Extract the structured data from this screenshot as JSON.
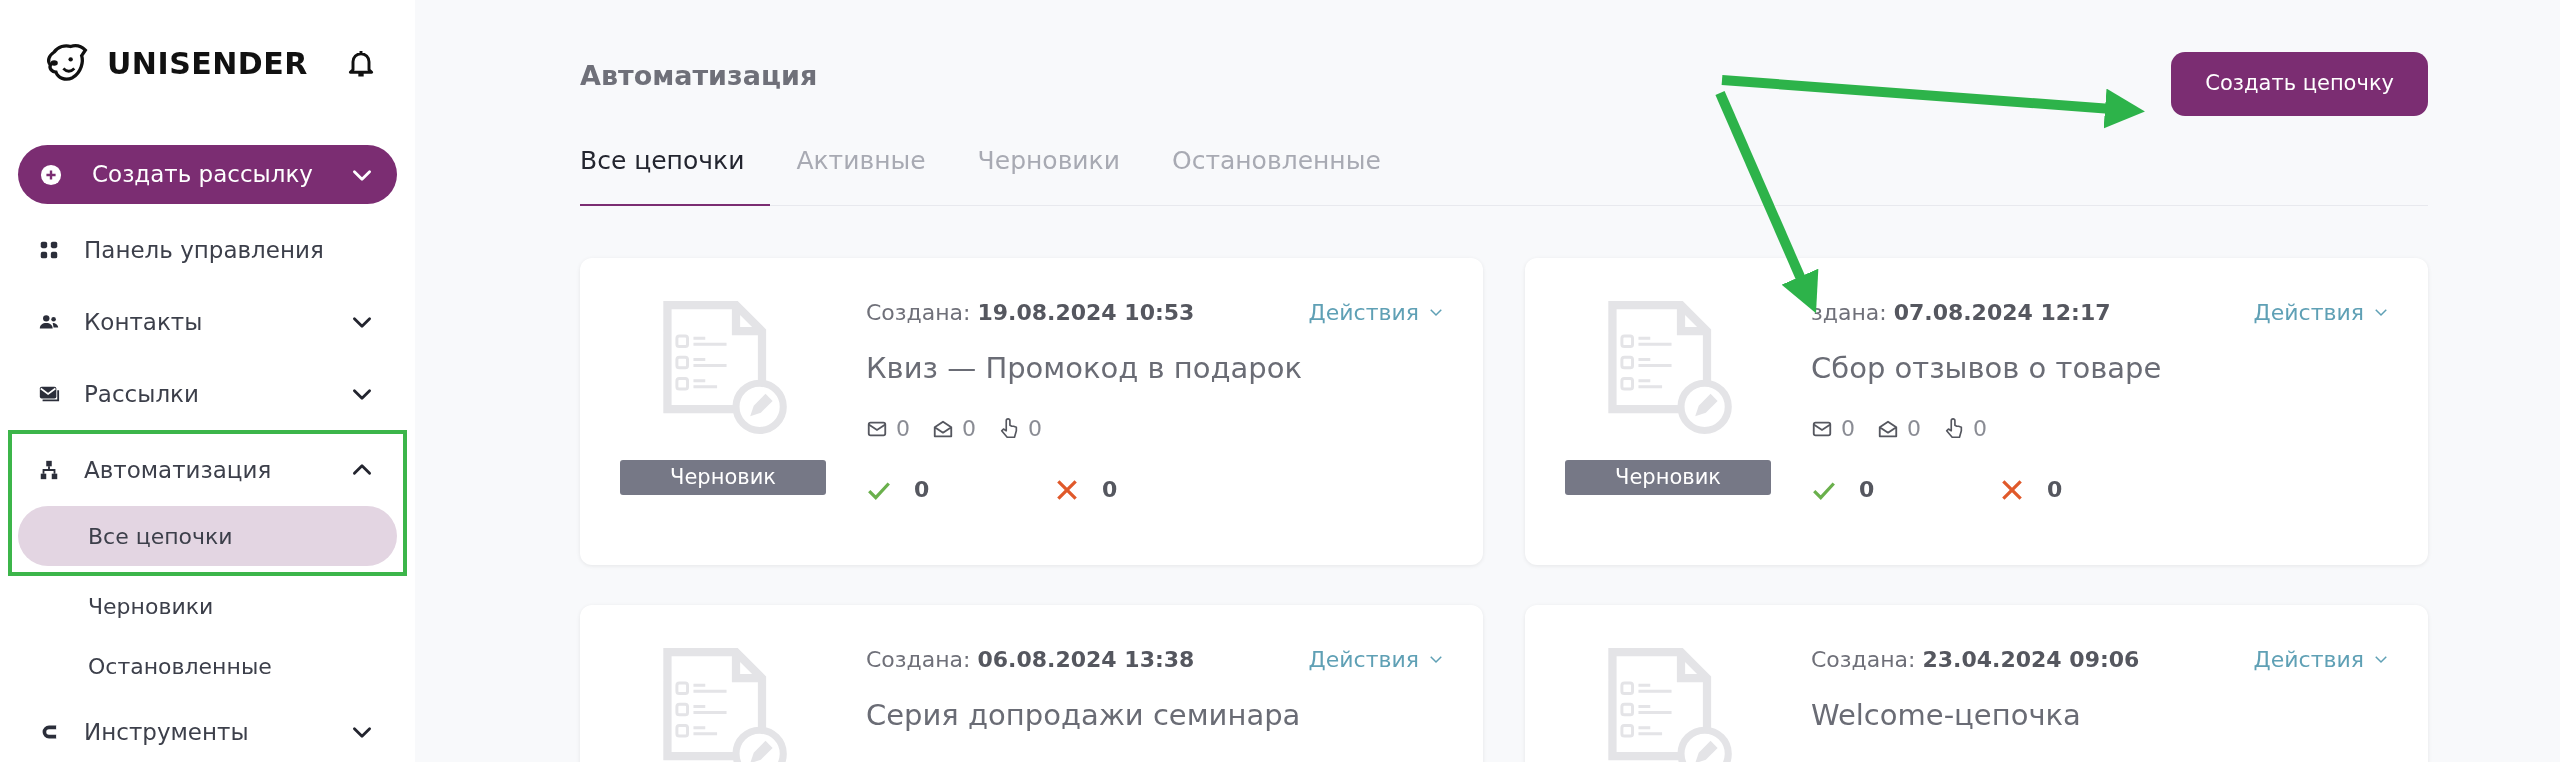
{
  "sidebar": {
    "logo": "UNISENDER",
    "create_button": {
      "label": "Создать рассылку",
      "expanded": false
    },
    "items": [
      {
        "label": "Панель управления",
        "kind": "link"
      },
      {
        "label": "Контакты",
        "kind": "group",
        "expanded": false
      },
      {
        "label": "Рассылки",
        "kind": "group",
        "expanded": false
      },
      {
        "label": "Автоматизация",
        "kind": "group",
        "expanded": true,
        "children": [
          {
            "label": "Все цепочки",
            "selected": true
          },
          {
            "label": "Черновики",
            "selected": false
          },
          {
            "label": "Остановленные",
            "selected": false
          }
        ]
      },
      {
        "label": "Инструменты",
        "kind": "group",
        "expanded": false
      }
    ]
  },
  "page": {
    "title": "Автоматизация",
    "create_button": "Создать цепочку",
    "tabs": [
      {
        "label": "Все цепочки",
        "selected": true
      },
      {
        "label": "Активные",
        "selected": false
      },
      {
        "label": "Черновики",
        "selected": false
      },
      {
        "label": "Остановленные",
        "selected": false
      }
    ]
  },
  "cards": [
    {
      "created_label": "Создана:",
      "created": "19.08.2024 10:53",
      "actions": "Действия",
      "title": "Квиз — Промокод в подарок",
      "sent": "0",
      "opened": "0",
      "clicked": "0",
      "status": "Черновик",
      "success": "0",
      "errors": "0"
    },
    {
      "created_label": "здана:",
      "created": "07.08.2024 12:17",
      "actions": "Действия",
      "title": "Сбор отзывов о товаре",
      "sent": "0",
      "opened": "0",
      "clicked": "0",
      "status": "Черновик",
      "success": "0",
      "errors": "0"
    },
    {
      "created_label": "Создана:",
      "created": "06.08.2024 13:38",
      "actions": "Действия",
      "title": "Серия допродажи семинара"
    },
    {
      "created_label": "Создана:",
      "created": "23.04.2024 09:06",
      "actions": "Действия",
      "title": "Welcome-цепочка"
    }
  ]
}
